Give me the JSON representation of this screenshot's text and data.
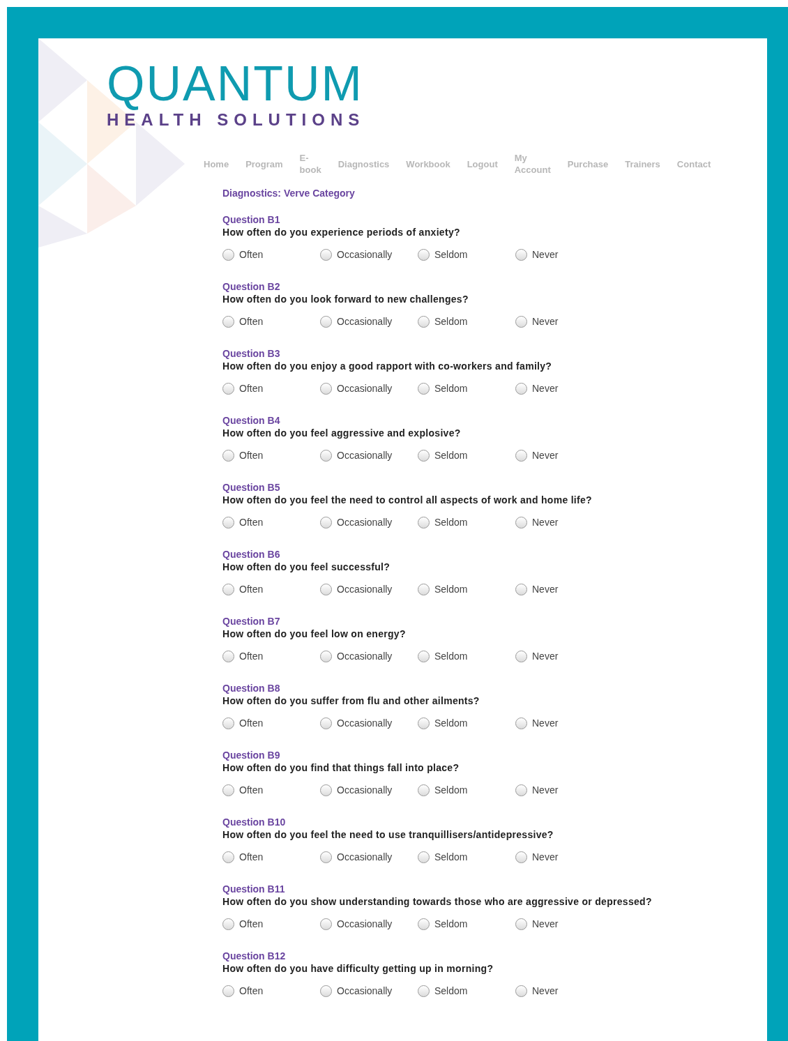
{
  "logo": {
    "title": "QUANTUM",
    "subtitle": "HEALTH SOLUTIONS"
  },
  "nav": [
    "Home",
    "Program",
    "E-book",
    "Diagnostics",
    "Workbook",
    "Logout",
    "My Account",
    "Purchase",
    "Trainers",
    "Contact"
  ],
  "heading": "Diagnostics: Verve Category",
  "questions": [
    {
      "label": "Question B1",
      "text": "How often do you experience periods of anxiety?",
      "options": [
        {
          "label": "Often",
          "selected": false
        },
        {
          "label": "Occasionally",
          "selected": false
        },
        {
          "label": "Seldom",
          "selected": false
        },
        {
          "label": "Never",
          "selected": false
        }
      ]
    },
    {
      "label": "Question B2",
      "text": "How often do you look forward to new challenges?",
      "options": [
        {
          "label": "Often",
          "selected": false
        },
        {
          "label": "Occasionally",
          "selected": false
        },
        {
          "label": "Seldom",
          "selected": false
        },
        {
          "label": "Never",
          "selected": false
        }
      ]
    },
    {
      "label": "Question B3",
      "text": "How often do you enjoy a good rapport with co-workers and family?",
      "options": [
        {
          "label": "Often",
          "selected": false
        },
        {
          "label": "Occasionally",
          "selected": false
        },
        {
          "label": "Seldom",
          "selected": false
        },
        {
          "label": "Never",
          "selected": false
        }
      ]
    },
    {
      "label": "Question B4",
      "text": "How often do you feel aggressive and explosive?",
      "options": [
        {
          "label": "Often",
          "selected": false
        },
        {
          "label": "Occasionally",
          "selected": false
        },
        {
          "label": "Seldom",
          "selected": false
        },
        {
          "label": "Never",
          "selected": false
        }
      ]
    },
    {
      "label": "Question B5",
      "text": "How often do you feel the need to control all aspects of work and home life?",
      "options": [
        {
          "label": "Often",
          "selected": false
        },
        {
          "label": "Occasionally",
          "selected": false
        },
        {
          "label": "Seldom",
          "selected": false
        },
        {
          "label": "Never",
          "selected": false
        }
      ]
    },
    {
      "label": "Question B6",
      "text": "How often do you feel successful?",
      "options": [
        {
          "label": "Often",
          "selected": false
        },
        {
          "label": "Occasionally",
          "selected": false
        },
        {
          "label": "Seldom",
          "selected": false
        },
        {
          "label": "Never",
          "selected": false
        }
      ]
    },
    {
      "label": "Question B7",
      "text": "How often do you feel low on energy?",
      "options": [
        {
          "label": "Often",
          "selected": false
        },
        {
          "label": "Occasionally",
          "selected": false
        },
        {
          "label": "Seldom",
          "selected": false
        },
        {
          "label": "Never",
          "selected": false
        }
      ]
    },
    {
      "label": "Question B8",
      "text": "How often do you suffer from flu and other ailments?",
      "options": [
        {
          "label": "Often",
          "selected": false
        },
        {
          "label": "Occasionally",
          "selected": false
        },
        {
          "label": "Seldom",
          "selected": false
        },
        {
          "label": "Never",
          "selected": false
        }
      ]
    },
    {
      "label": "Question B9",
      "text": "How often do you find that things fall into place?",
      "options": [
        {
          "label": "Often",
          "selected": false
        },
        {
          "label": "Occasionally",
          "selected": false
        },
        {
          "label": "Seldom",
          "selected": false
        },
        {
          "label": "Never",
          "selected": false
        }
      ]
    },
    {
      "label": "Question B10",
      "text": "How often do you feel the need to use tranquillisers/antidepressive?",
      "options": [
        {
          "label": "Often",
          "selected": false
        },
        {
          "label": "Occasionally",
          "selected": false
        },
        {
          "label": "Seldom",
          "selected": false
        },
        {
          "label": "Never",
          "selected": false
        }
      ]
    },
    {
      "label": "Question B11",
      "text": "How often do you show understanding towards those who are aggressive or depressed?",
      "options": [
        {
          "label": "Often",
          "selected": false
        },
        {
          "label": "Occasionally",
          "selected": false
        },
        {
          "label": "Seldom",
          "selected": false
        },
        {
          "label": "Never",
          "selected": false
        }
      ]
    },
    {
      "label": "Question B12",
      "text": "How often do you have difficulty getting up in morning?",
      "options": [
        {
          "label": "Often",
          "selected": false
        },
        {
          "label": "Occasionally",
          "selected": false
        },
        {
          "label": "Seldom",
          "selected": false
        },
        {
          "label": "Never",
          "selected": false
        }
      ]
    }
  ]
}
